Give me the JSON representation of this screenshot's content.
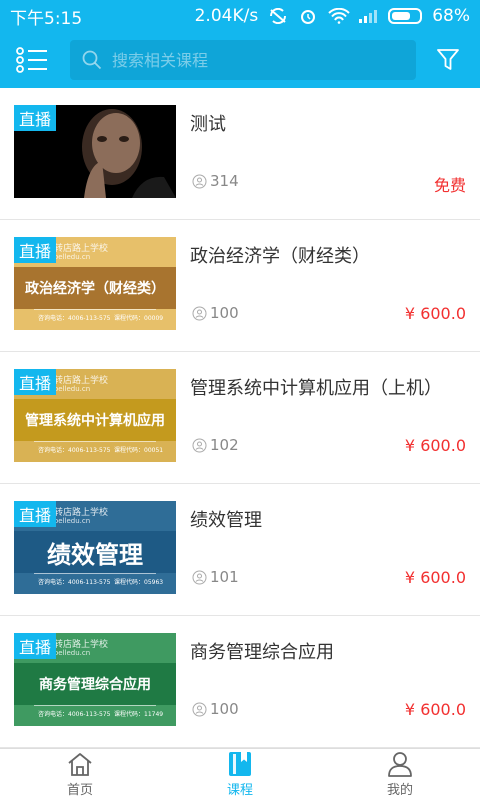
{
  "status_bar": {
    "time": "下午5:15",
    "net_speed": "2.04K/s",
    "battery_percent": "68%",
    "battery_level": 0.68,
    "icons": [
      "sync-off-icon",
      "alarm-icon",
      "wifi-icon",
      "signal-icon",
      "battery-icon"
    ]
  },
  "app_bar": {
    "search_placeholder": "搜索相关课程",
    "icons": [
      "menu-icon",
      "search-icon",
      "filter-icon"
    ]
  },
  "live_label": "直播",
  "courses": [
    {
      "title": "测试",
      "viewers": "314",
      "price": "免费",
      "thumb": {
        "kind": "photo"
      }
    },
    {
      "title": "政治经济学（财经类）",
      "viewers": "100",
      "price": "¥ 600.0",
      "thumb": {
        "kind": "banner",
        "bg": "#e7c06a",
        "band": "#a8742f",
        "band_text": "政治经济学（财经类）",
        "school": "转店路上学校",
        "site": "oelledu.cn",
        "contact": "咨询电话：4006-113-575",
        "code": "课程代码：00009"
      }
    },
    {
      "title": "管理系统中计算机应用（上机）",
      "viewers": "102",
      "price": "¥ 600.0",
      "thumb": {
        "kind": "banner",
        "bg": "#d9b254",
        "band": "#c49a1e",
        "band_text": "管理系统中计算机应用",
        "school": "转店路上学校",
        "site": "oelledu.cn",
        "contact": "咨询电话：4006-113-575",
        "code": "课程代码：00051"
      }
    },
    {
      "title": "绩效管理",
      "viewers": "101",
      "price": "¥ 600.0",
      "thumb": {
        "kind": "banner",
        "bg": "#2f6d97",
        "band": "#1e5a85",
        "band_text": "绩效管理",
        "big": true,
        "school": "转店路上学校",
        "site": "oelledu.cn",
        "contact": "咨询电话：4006-113-575",
        "code": "课程代码：05963"
      }
    },
    {
      "title": "商务管理综合应用",
      "viewers": "100",
      "price": "¥ 600.0",
      "thumb": {
        "kind": "banner",
        "bg": "#3f9a61",
        "band": "#1f7a44",
        "band_text": "商务管理综合应用",
        "school": "转店路上学校",
        "site": "oelledu.cn",
        "contact": "咨询电话：4006-113-575",
        "code": "课程代码：11749"
      }
    }
  ],
  "tabs": [
    {
      "label": "首页",
      "icon": "home-icon",
      "active": false
    },
    {
      "label": "课程",
      "icon": "book-icon",
      "active": true
    },
    {
      "label": "我的",
      "icon": "user-icon",
      "active": false
    }
  ],
  "colors": {
    "primary": "#13b7ee",
    "price": "#f23030"
  }
}
